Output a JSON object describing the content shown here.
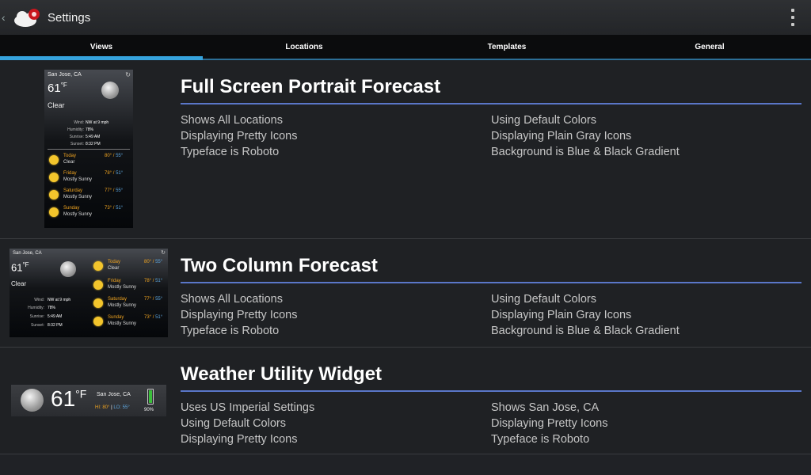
{
  "app": {
    "title": "Settings"
  },
  "tabs": [
    {
      "label": "Views",
      "active": true
    },
    {
      "label": "Locations",
      "active": false
    },
    {
      "label": "Templates",
      "active": false
    },
    {
      "label": "General",
      "active": false
    }
  ],
  "views": [
    {
      "title": "Full Screen Portrait Forecast",
      "props": [
        "Shows All Locations",
        "Using Default Colors",
        "Displaying Pretty Icons",
        "Displaying Plain Gray Icons",
        "Typeface is Roboto",
        "Background is Blue & Black Gradient"
      ]
    },
    {
      "title": "Two Column Forecast",
      "props": [
        "Shows All Locations",
        "Using Default Colors",
        "Displaying Pretty Icons",
        "Displaying Plain Gray Icons",
        "Typeface is Roboto",
        "Background is Blue & Black Gradient"
      ]
    },
    {
      "title": "Weather Utility Widget",
      "props": [
        "Uses US Imperial Settings",
        "Shows San Jose, CA",
        "Using Default Colors",
        "Displaying Pretty Icons",
        "Displaying Pretty Icons",
        "Typeface is Roboto"
      ]
    }
  ],
  "preview": {
    "location": "San Jose, CA",
    "temp": "61",
    "unit": "°F",
    "condition": "Clear",
    "wind_label": "Wind:",
    "wind": "NW at 9 mph",
    "humidity_label": "Humidity:",
    "humidity": "78%",
    "sunrise_label": "Sunrise:",
    "sunrise": "5:49 AM",
    "sunset_label": "Sunset:",
    "sunset": "8:32 PM",
    "forecast": [
      {
        "day": "Today",
        "desc": "Clear",
        "hi": "80°",
        "lo": "55°"
      },
      {
        "day": "Friday",
        "desc": "Mostly Sunny",
        "hi": "78°",
        "lo": "51°"
      },
      {
        "day": "Saturday",
        "desc": "Mostly Sunny",
        "hi": "77°",
        "lo": "55°"
      },
      {
        "day": "Sunday",
        "desc": "Mostly Sunny",
        "hi": "73°",
        "lo": "51°"
      }
    ],
    "widget_hi": "HI: 80°",
    "widget_lo": "LO: 55°",
    "battery": "90%"
  },
  "colors": {
    "accent_blue": "#36a3dc",
    "divider_blue": "#5a76c8",
    "tab_bg": "#0b0c0d",
    "forecast_orange": "#f0a420"
  }
}
